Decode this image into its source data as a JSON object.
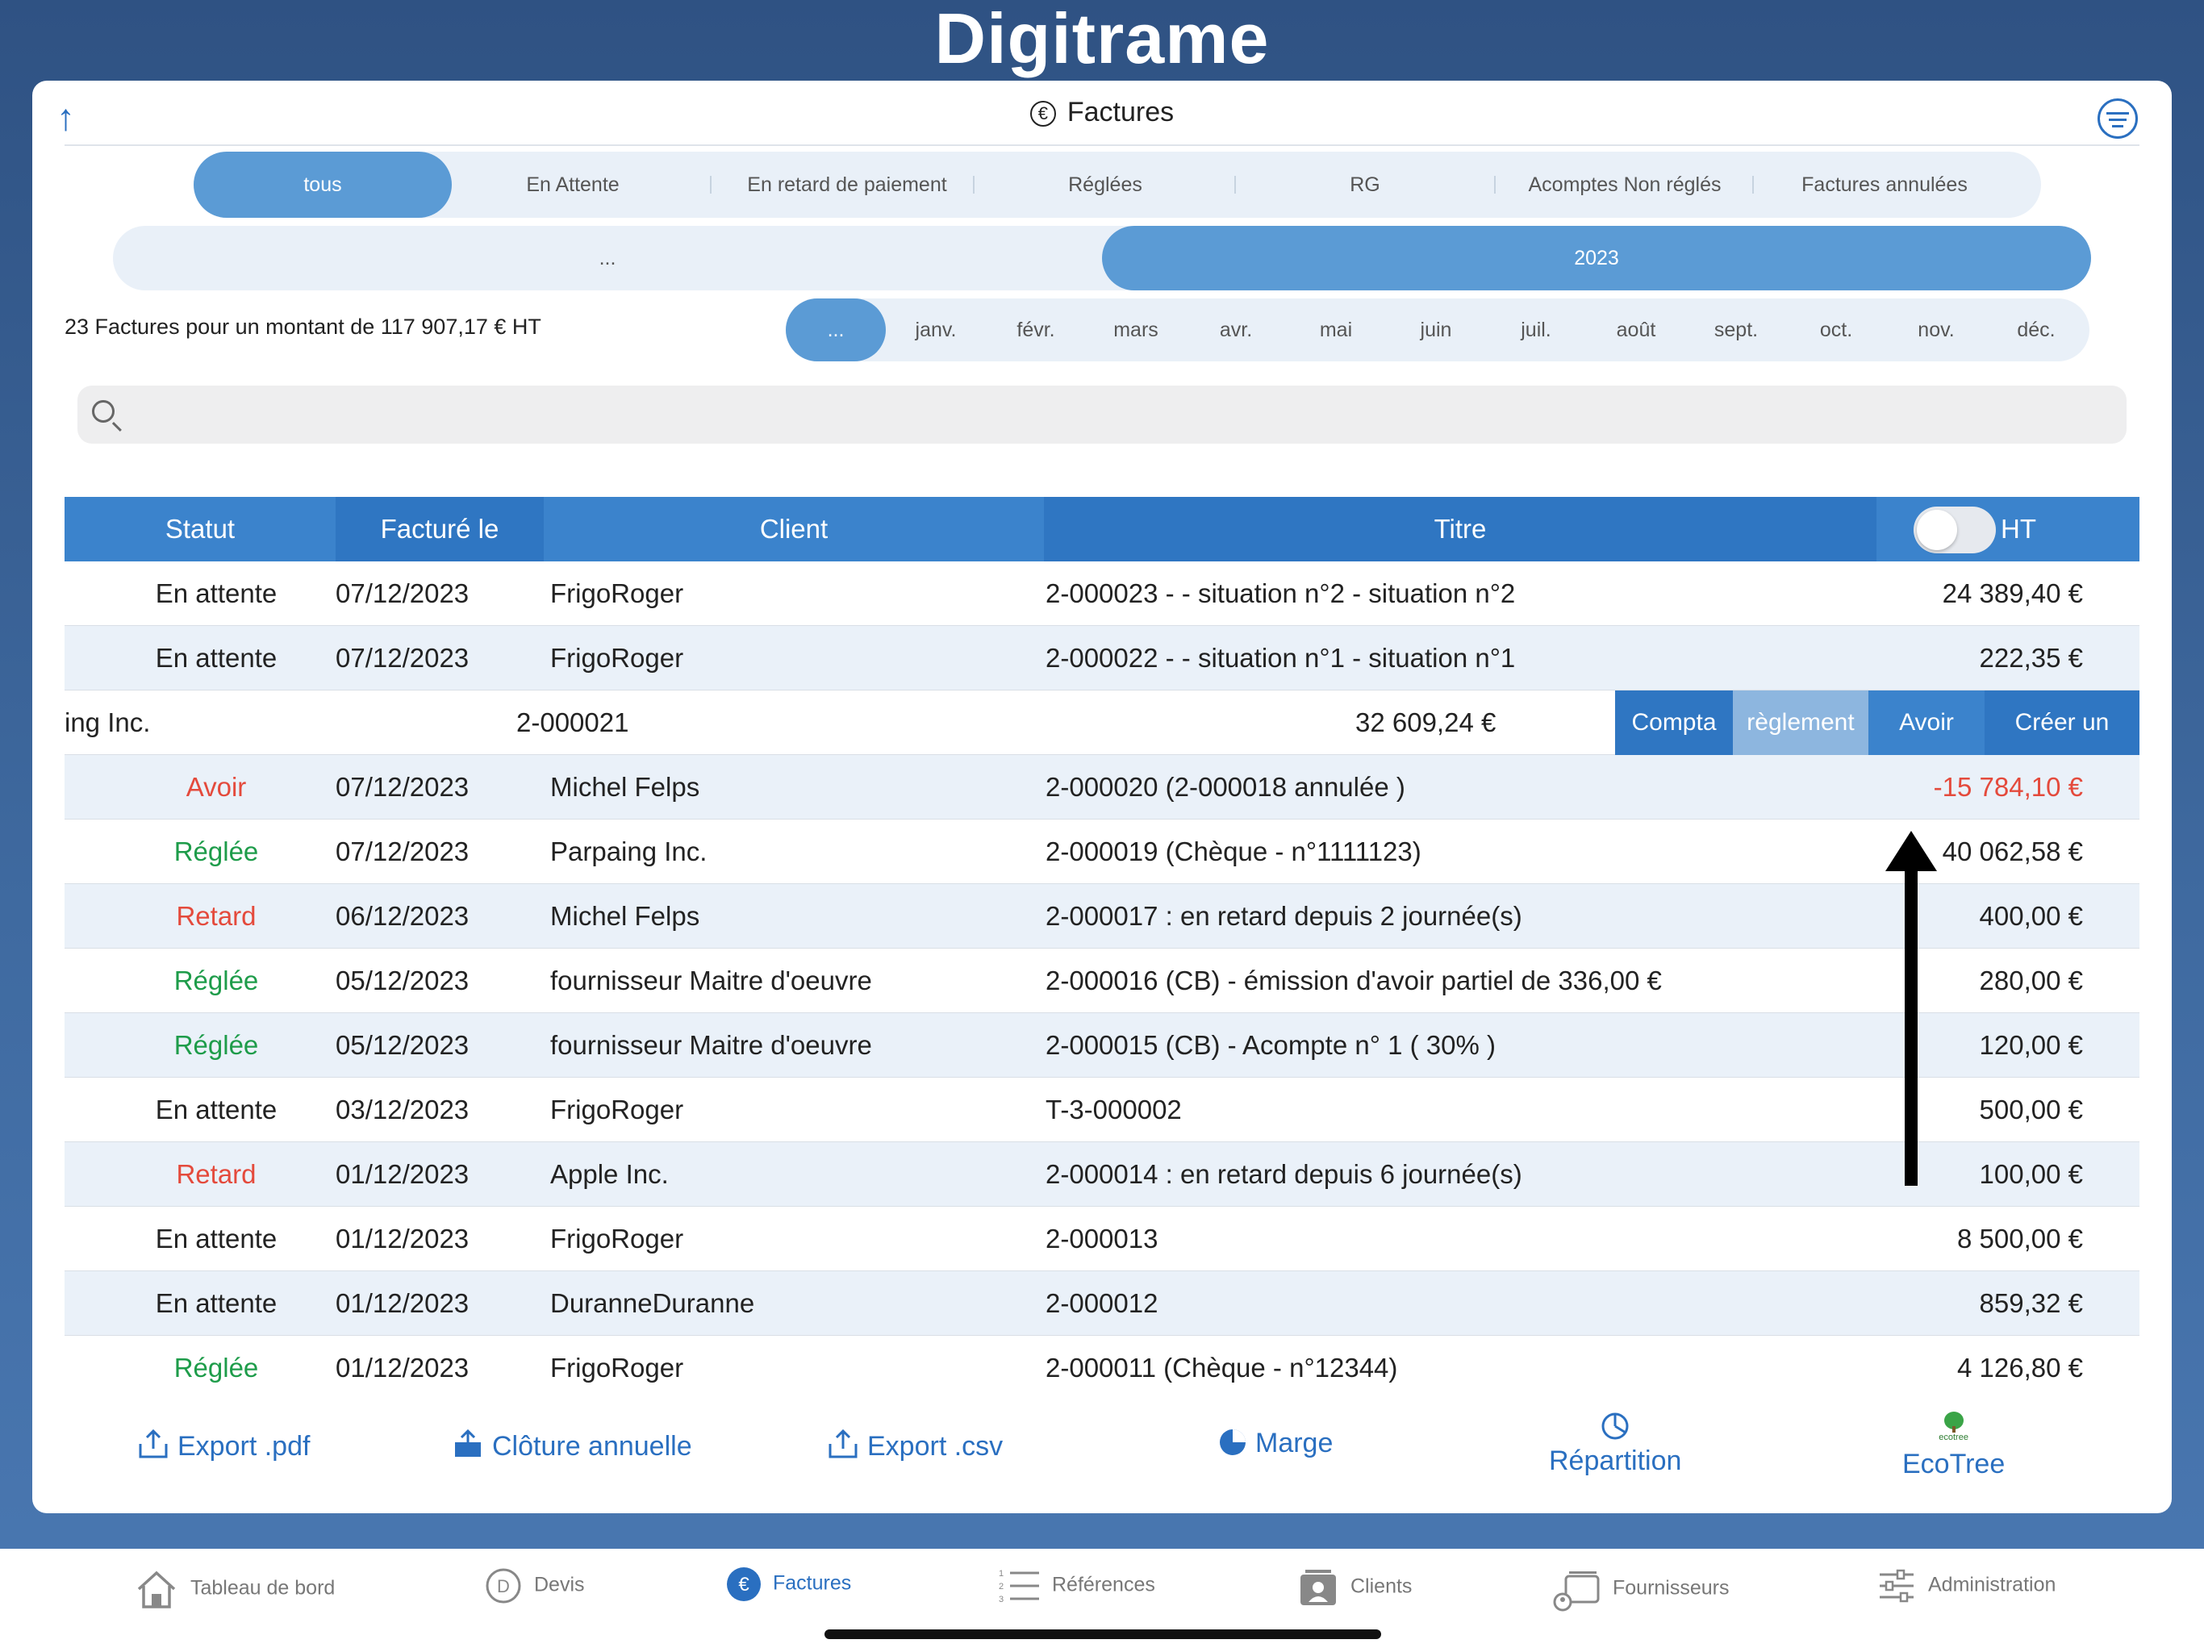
{
  "brand": "Digitrame",
  "header": {
    "title": "Factures"
  },
  "status_tabs": [
    "tous",
    "En Attente",
    "En retard de paiement",
    "Réglées",
    "RG",
    "Acomptes Non réglés",
    "Factures annulées"
  ],
  "year_tabs": [
    "...",
    "2023"
  ],
  "month_tabs": [
    "...",
    "janv.",
    "févr.",
    "mars",
    "avr.",
    "mai",
    "juin",
    "juil.",
    "août",
    "sept.",
    "oct.",
    "nov.",
    "déc."
  ],
  "summary": "23 Factures pour un montant de 117 907,17 € HT",
  "search": {
    "placeholder": ""
  },
  "table": {
    "headers": {
      "statut": "Statut",
      "facture": "Facturé le",
      "client": "Client",
      "titre": "Titre",
      "ht": "HT"
    },
    "rows": [
      {
        "statut": "En attente",
        "date": "07/12/2023",
        "client": "FrigoRoger",
        "titre": "2-000023 -  - situation n°2 - situation n°2",
        "montant": "24 389,40 €"
      },
      {
        "statut": "En attente",
        "date": "07/12/2023",
        "client": "FrigoRoger",
        "titre": "2-000022 -  - situation n°1 - situation n°1",
        "montant": "222,35 €"
      },
      {
        "statut": "Avoir",
        "date": "07/12/2023",
        "client": "Michel Felps",
        "titre": "2-000020   (2-000018 annulée )",
        "montant": "-15 784,10 €"
      },
      {
        "statut": "Réglée",
        "date": "07/12/2023",
        "client": "Parpaing Inc.",
        "titre": "2-000019 (Chèque - n°1111123)",
        "montant": "40 062,58 €"
      },
      {
        "statut": "Retard",
        "date": "06/12/2023",
        "client": "Michel Felps",
        "titre": "2-000017 : en retard depuis 2 journée(s)",
        "montant": "400,00 €"
      },
      {
        "statut": "Réglée",
        "date": "05/12/2023",
        "client": "fournisseur Maitre d'oeuvre",
        "titre": "2-000016 (CB) - émission d'avoir partiel de 336,00 €",
        "montant": "280,00 €"
      },
      {
        "statut": "Réglée",
        "date": "05/12/2023",
        "client": "fournisseur Maitre d'oeuvre",
        "titre": "2-000015 (CB) - Acompte n° 1  ( 30% )",
        "montant": "120,00 €"
      },
      {
        "statut": "En attente",
        "date": "03/12/2023",
        "client": "FrigoRoger",
        "titre": "T-3-000002",
        "montant": "500,00 €"
      },
      {
        "statut": "Retard",
        "date": "01/12/2023",
        "client": "Apple Inc.",
        "titre": "2-000014 : en retard depuis 6 journée(s)",
        "montant": "100,00 €"
      },
      {
        "statut": "En attente",
        "date": "01/12/2023",
        "client": "FrigoRoger",
        "titre": "2-000013",
        "montant": "8 500,00 €"
      },
      {
        "statut": "En attente",
        "date": "01/12/2023",
        "client": "DuranneDuranne",
        "titre": "2-000012",
        "montant": "859,32 €"
      },
      {
        "statut": "Réglée",
        "date": "01/12/2023",
        "client": "FrigoRoger",
        "titre": "2-000011 (Chèque - n°12344)",
        "montant": "4 126,80 €"
      }
    ],
    "swiped_row": {
      "client": "ing Inc.",
      "titre": "2-000021",
      "montant": "32 609,24 €",
      "actions": [
        "Compta",
        "règlement",
        "Avoir",
        "Créer un devis"
      ]
    }
  },
  "toolbar": {
    "export_pdf": "Export  .pdf",
    "cloture": "Clôture annuelle",
    "export_csv": "Export  .csv",
    "marge": "Marge",
    "repartition": "Répartition",
    "ecotree_logo": "ecotree",
    "ecotree": "EcoTree"
  },
  "tabbar": [
    "Tableau de bord",
    "Devis",
    "Factures",
    "Références",
    "Clients",
    "Fournisseurs",
    "Administration"
  ],
  "colors": {
    "accent": "#2a6fc0",
    "selected": "#5b9bd5",
    "header": "#3b83cc",
    "green": "#1e9c4a",
    "red": "#e44a3c",
    "avoir_action": "#3b83cc",
    "compta_action": "#2f76c2",
    "reglement_action": "#8db6df"
  }
}
